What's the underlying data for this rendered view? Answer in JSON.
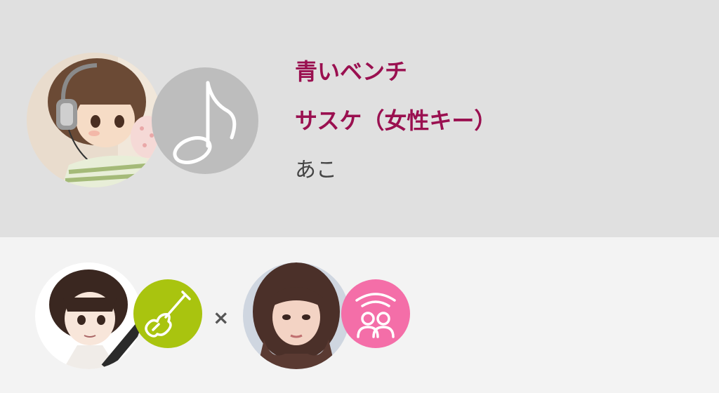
{
  "song": {
    "title": "青いベンチ",
    "subtitle": "サスケ（女性キー）",
    "artist": "あこ"
  },
  "performers": {
    "separator": "×",
    "left": {
      "avatar": "anime-boy-with-guitar-avatar",
      "badge_icon": "guitar-icon",
      "badge_color": "#a9c40f"
    },
    "right": {
      "avatar": "woman-photo-avatar",
      "badge_icon": "singers-icon",
      "badge_color": "#f46ea8"
    }
  },
  "main_badge": {
    "icon": "music-note-icon",
    "color": "#bdbdbd"
  },
  "colors": {
    "title": "#9a1050",
    "top_background": "#e0e0e0",
    "bottom_background": "#f3f3f3"
  }
}
